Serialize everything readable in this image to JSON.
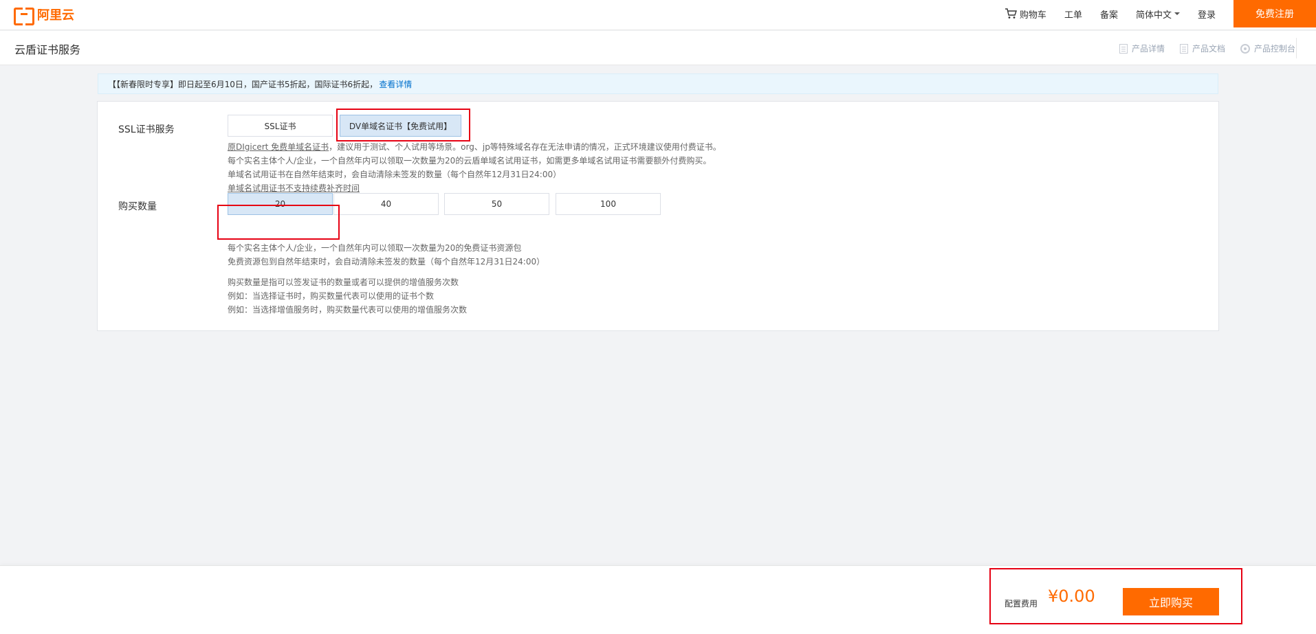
{
  "header": {
    "logo_text": "阿里云",
    "nav": {
      "cart": "购物车",
      "ticket": "工单",
      "filing": "备案",
      "language": "简体中文",
      "login": "登录",
      "register": "免费注册"
    }
  },
  "subheader": {
    "title": "云盾证书服务",
    "links": {
      "details": "产品详情",
      "docs": "产品文档",
      "console": "产品控制台"
    }
  },
  "notice": {
    "text": "【【新春限时专享】即日起至6月10日，国产证书5折起，国际证书6折起，",
    "link": "查看详情"
  },
  "ssl_service": {
    "label": "SSL证书服务",
    "options": [
      "SSL证书",
      "DV单域名证书【免费试用】"
    ],
    "selected": "DV单域名证书【免费试用】",
    "desc_line1_link": "原DIgicert 免费单域名证书",
    "desc_line1_rest": "，建议用于测试、个人试用等场景。org、jp等特殊域名存在无法申请的情况，正式环境建议使用付费证书。",
    "desc_line2": "每个实名主体个人/企业，一个自然年内可以领取一次数量为20的云盾单域名试用证书，如需更多单域名试用证书需要额外付费购买。",
    "desc_line3": "单域名试用证书在自然年结束时，会自动清除未签发的数量（每个自然年12月31日24:00）",
    "desc_line4": "单域名试用证书不支持续费补齐时间"
  },
  "quantity": {
    "label": "购买数量",
    "options": [
      "20",
      "40",
      "50",
      "100"
    ],
    "selected": "20",
    "desc_line1": "每个实名主体个人/企业，一个自然年内可以领取一次数量为20的免费证书资源包",
    "desc_line2": "免费资源包到自然年结束时，会自动清除未签发的数量（每个自然年12月31日24:00）",
    "desc_line3": "购买数量是指可以签发证书的数量或者可以提供的增值服务次数",
    "desc_line4": "例如：当选择证书时，购买数量代表可以使用的证书个数",
    "desc_line5": "例如：当选择增值服务时，购买数量代表可以使用的增值服务次数"
  },
  "footer": {
    "fee_label": "配置费用",
    "fee_value": "¥0.00",
    "buy_label": "立即购买"
  },
  "colors": {
    "brand": "#ff6a00",
    "link": "#0070cc",
    "highlight": "#e60012",
    "selected_bg": "#d8e7f6"
  }
}
